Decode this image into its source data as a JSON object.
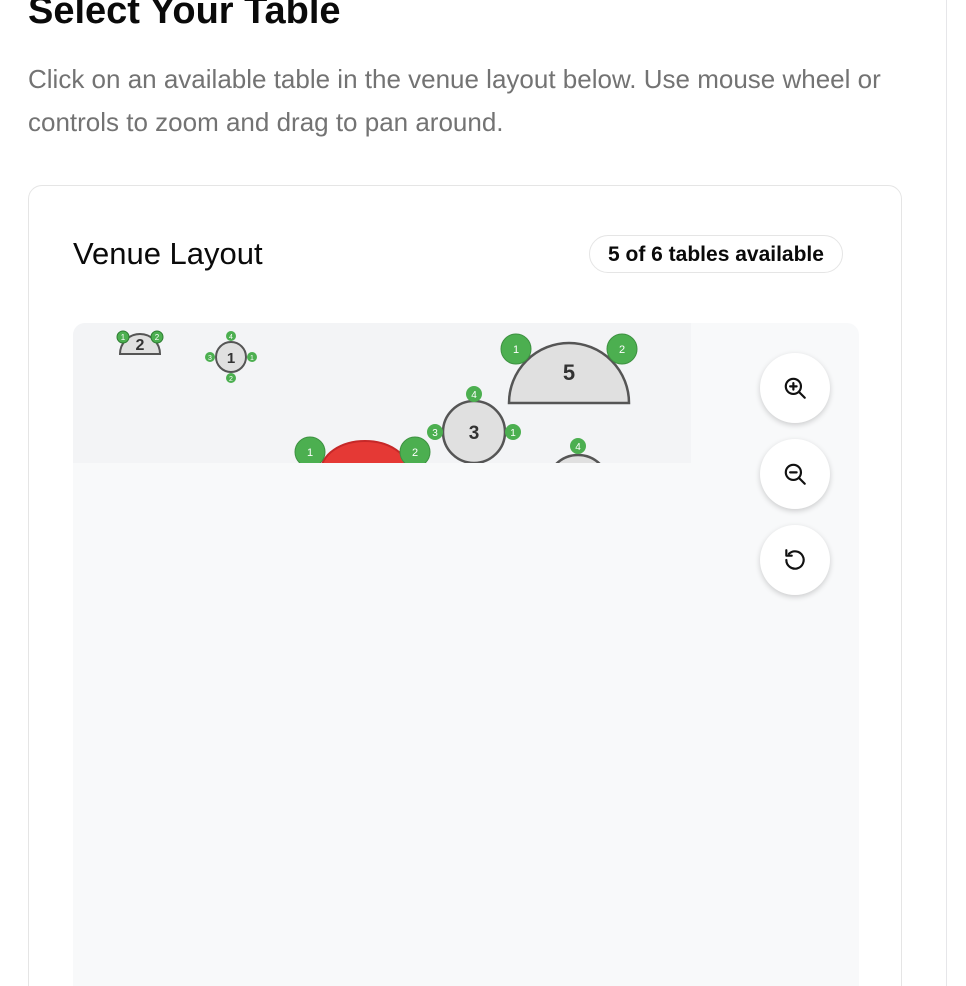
{
  "header": {
    "title": "Select Your Table",
    "subtitle": "Click on an available table in the venue layout below. Use mouse wheel or controls to zoom and drag to pan around."
  },
  "venue": {
    "title": "Venue Layout",
    "availability": "5 of 6 tables available",
    "colors": {
      "seat_available": "#4caf50",
      "table_available": "#e0e0e0",
      "table_unavailable": "#e53935",
      "canvas_bg": "#f8f9fa"
    },
    "tables": [
      {
        "label": "2",
        "shape": "half-round",
        "status": "available",
        "seats": [
          "1",
          "2"
        ]
      },
      {
        "label": "1",
        "shape": "round",
        "status": "available",
        "seats": [
          "4",
          "3",
          "1",
          "2"
        ]
      },
      {
        "label": "5",
        "shape": "half-round",
        "status": "available",
        "seats": [
          "1",
          "2"
        ]
      },
      {
        "label": "3",
        "shape": "round",
        "status": "available",
        "seats": [
          "4",
          "3",
          "1"
        ]
      },
      {
        "label": "",
        "shape": "half-round",
        "status": "unavailable",
        "seats": [
          "1",
          "2"
        ]
      },
      {
        "label": "",
        "shape": "round",
        "status": "available",
        "seats": [
          "4"
        ]
      }
    ],
    "controls": [
      {
        "name": "zoom-in",
        "icon": "zoom-in-icon"
      },
      {
        "name": "zoom-out",
        "icon": "zoom-out-icon"
      },
      {
        "name": "reset-view",
        "icon": "reset-icon"
      }
    ]
  }
}
